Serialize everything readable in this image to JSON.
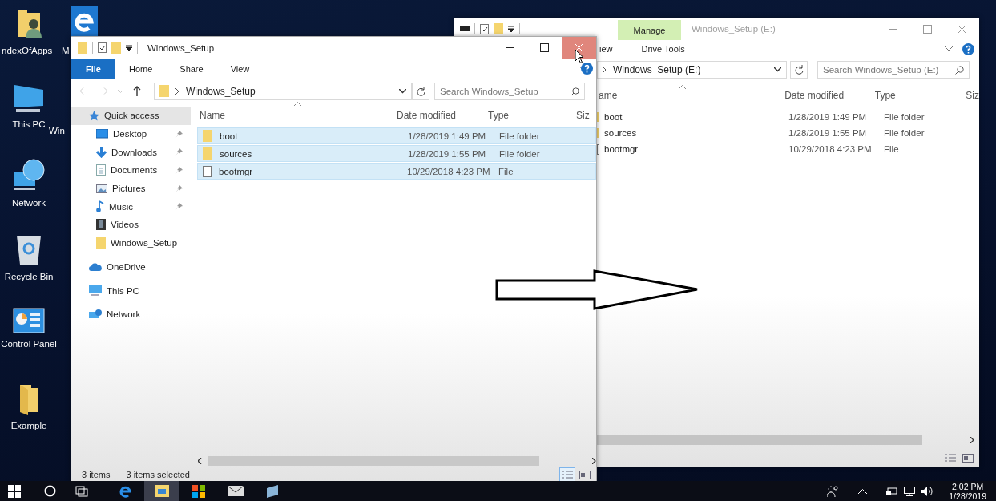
{
  "desktop_icons": [
    {
      "label": "ndexOfApps",
      "kind": "user-folder"
    },
    {
      "label": "This PC",
      "kind": "pc"
    },
    {
      "label": "Network",
      "kind": "network"
    },
    {
      "label": "Recycle Bin",
      "kind": "recycle"
    },
    {
      "label": "Control Panel",
      "kind": "control-panel"
    },
    {
      "label": "Example",
      "kind": "folder"
    }
  ],
  "desktop_icons_cut": [
    {
      "label": "M",
      "kind": "edge"
    },
    {
      "label": "Win",
      "kind": "none"
    }
  ],
  "back_window": {
    "title": "Windows_Setup (E:)",
    "context_tab": "Manage",
    "ribbon_tabs": [
      {
        "label": "iew",
        "selected": false
      },
      {
        "label": "Drive Tools",
        "selected": false
      }
    ],
    "address": "Windows_Setup (E:)",
    "search": {
      "placeholder": "Search Windows_Setup (E:)"
    },
    "columns": [
      "ame",
      "Date modified",
      "Type",
      "Siz"
    ],
    "rows": [
      {
        "name": "boot",
        "kind": "folder",
        "date": "1/28/2019 1:49 PM",
        "type": "File folder",
        "selected": false
      },
      {
        "name": "sources",
        "kind": "folder",
        "date": "1/28/2019 1:55 PM",
        "type": "File folder",
        "selected": false
      },
      {
        "name": "bootmgr",
        "kind": "file",
        "date": "10/29/2018 4:23 PM",
        "type": "File",
        "selected": false
      }
    ],
    "view_buttons": [
      {
        "kind": "details",
        "selected": false
      },
      {
        "kind": "tiles",
        "selected": false
      }
    ]
  },
  "front_window": {
    "title": "Windows_Setup",
    "ribbon_tabs": [
      {
        "label": "File",
        "kind": "file",
        "selected": false
      },
      {
        "label": "Home",
        "kind": "tab",
        "selected": false
      },
      {
        "label": "Share",
        "kind": "tab",
        "selected": false
      },
      {
        "label": "View",
        "kind": "tab",
        "selected": false
      }
    ],
    "address": "Windows_Setup",
    "search": {
      "placeholder": "Search Windows_Setup"
    },
    "nav": [
      {
        "label": "Quick access",
        "kind": "star",
        "selected": true,
        "children": [
          {
            "label": "Desktop",
            "kind": "desktop",
            "pinned": true,
            "selected": false
          },
          {
            "label": "Downloads",
            "kind": "downloads",
            "pinned": true,
            "selected": false
          },
          {
            "label": "Documents",
            "kind": "documents",
            "pinned": true,
            "selected": false
          },
          {
            "label": "Pictures",
            "kind": "pictures",
            "pinned": true,
            "selected": false
          },
          {
            "label": "Music",
            "kind": "music",
            "pinned": true,
            "selected": false
          },
          {
            "label": "Videos",
            "kind": "videos",
            "pinned": false,
            "selected": false
          },
          {
            "label": "Windows_Setup",
            "kind": "folder",
            "pinned": false,
            "selected": false
          }
        ]
      },
      {
        "label": "OneDrive",
        "kind": "onedrive",
        "selected": false
      },
      {
        "label": "This PC",
        "kind": "pc",
        "selected": false
      },
      {
        "label": "Network",
        "kind": "network",
        "selected": false
      }
    ],
    "columns": [
      "Name",
      "Date modified",
      "Type",
      "Siz"
    ],
    "rows": [
      {
        "name": "boot",
        "kind": "folder",
        "date": "1/28/2019 1:49 PM",
        "type": "File folder",
        "selected": true
      },
      {
        "name": "sources",
        "kind": "folder",
        "date": "1/28/2019 1:55 PM",
        "type": "File folder",
        "selected": true
      },
      {
        "name": "bootmgr",
        "kind": "file",
        "date": "10/29/2018 4:23 PM",
        "type": "File",
        "selected": true
      }
    ],
    "status": {
      "count": "3 items",
      "selection": "3 items selected"
    },
    "view_buttons": [
      {
        "kind": "details",
        "selected": true
      },
      {
        "kind": "tiles",
        "selected": false
      }
    ]
  },
  "taskbar": {
    "apps": [
      {
        "kind": "edge",
        "selected": false
      },
      {
        "kind": "explorer",
        "selected": true
      },
      {
        "kind": "store",
        "selected": false
      },
      {
        "kind": "mail",
        "selected": false
      },
      {
        "kind": "app",
        "selected": false
      }
    ],
    "time": "2:02 PM",
    "date": "1/28/2019"
  }
}
